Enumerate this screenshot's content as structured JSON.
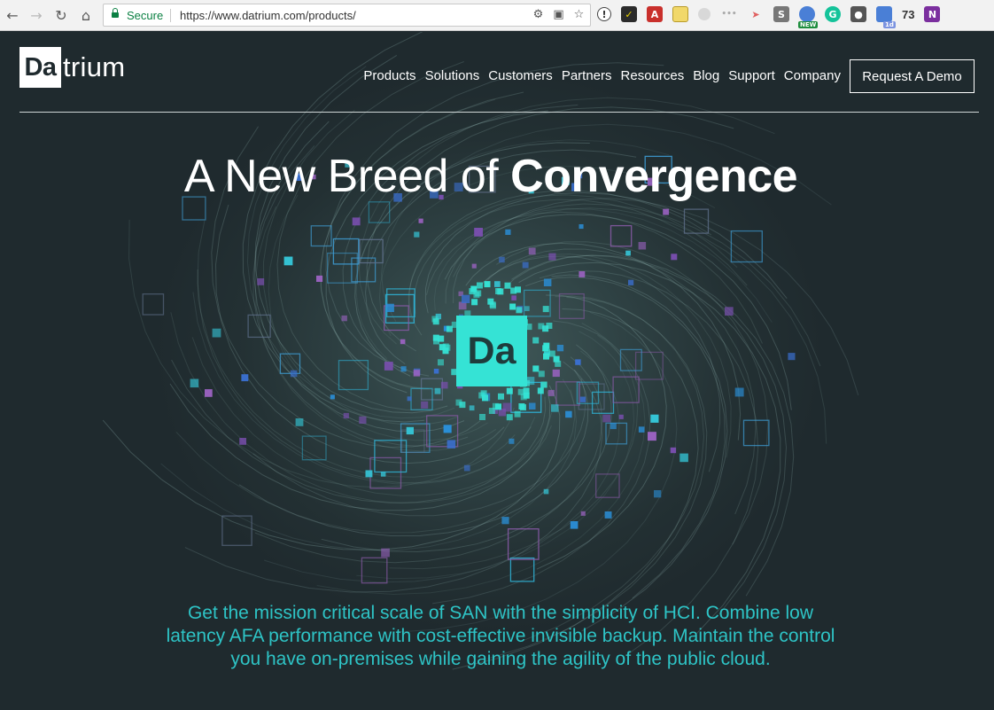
{
  "browser": {
    "secure_label": "Secure",
    "url": "https://www.datrium.com/products/",
    "extension_count": "73",
    "extension_badge": "NEW",
    "extension_badge_2": "1d",
    "icons": [
      "back-icon",
      "forward-icon",
      "reload-icon",
      "home-icon",
      "lock-icon",
      "content-blocked-icon",
      "popup-blocked-icon",
      "bookmark-star-icon"
    ]
  },
  "header": {
    "logo_box": "Da",
    "logo_text": "trium",
    "nav": [
      "Products",
      "Solutions",
      "Customers",
      "Partners",
      "Resources",
      "Blog",
      "Support",
      "Company"
    ],
    "cta": "Request A Demo"
  },
  "hero": {
    "headline_light": "A New Breed of",
    "headline_bold": "Convergence",
    "center_logo": "Da",
    "body": "Get the mission critical scale of SAN with the simplicity of HCI. Combine low latency AFA performance with cost-effective invisible backup. Maintain the control you have on-premises while gaining the agility of the public cloud."
  },
  "colors": {
    "background": "#1f2a2e",
    "accent_teal": "#35e3d5",
    "body_text": "#2ec4c6",
    "square_blue": "#2a8fd8",
    "square_purple": "#7a4fb0"
  }
}
